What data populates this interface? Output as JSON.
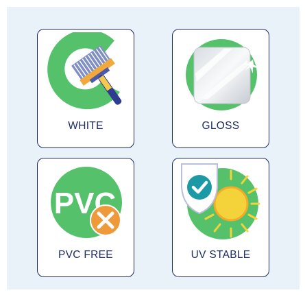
{
  "colors": {
    "green": "#56c16b",
    "navy": "#1c2b66",
    "teal": "#1b9aa6",
    "orange": "#ee9a3a",
    "panel_bg": "#e9f1f9"
  },
  "cards": [
    {
      "label": "WHITE",
      "icon": "paint-brush-icon"
    },
    {
      "label": "GLOSS",
      "icon": "gloss-sheen-icon"
    },
    {
      "label": "PVC FREE",
      "icon": "pvc-free-icon",
      "icon_text": "PVC"
    },
    {
      "label": "UV STABLE",
      "icon": "uv-stable-sun-icon"
    }
  ]
}
